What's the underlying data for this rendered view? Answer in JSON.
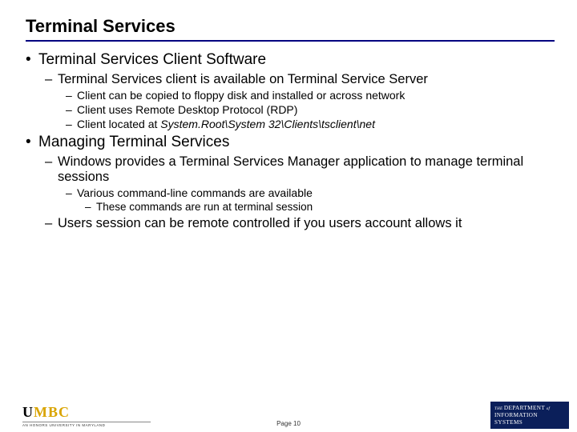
{
  "title": "Terminal Services",
  "bullets": {
    "b1": "Terminal Services Client Software",
    "b1_1": "Terminal Services client is available on Terminal Service Server",
    "b1_1_1": "Client can be copied to floppy disk and installed or across network",
    "b1_1_2": "Client uses Remote Desktop Protocol (RDP)",
    "b1_1_3_pre": "Client located at ",
    "b1_1_3_path": "System.Root\\System 32\\Clients\\tsclient\\net",
    "b2": "Managing Terminal Services",
    "b2_1": "Windows provides a Terminal Services Manager application to manage terminal sessions",
    "b2_1_1": "Various command-line commands are available",
    "b2_1_1_1": "These commands are run at terminal session",
    "b2_2": "Users session can be remote controlled if you users account allows it"
  },
  "footer": {
    "logo_u": "U",
    "logo_mbc": "MBC",
    "logo_sub": "AN HONORS UNIVERSITY IN MARYLAND",
    "page": "Page 10",
    "dept_the": "THE",
    "dept_l1": "DEPARTMENT",
    "dept_of": "of",
    "dept_l2": "INFORMATION",
    "dept_l3": "SYSTEMS"
  }
}
